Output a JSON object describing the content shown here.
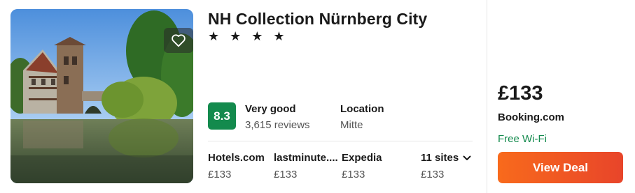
{
  "hotel": {
    "name": "NH Collection Nürnberg City",
    "stars": "★ ★ ★ ★",
    "star_count": 4,
    "favorite_icon": "heart-outline-icon"
  },
  "rating": {
    "score": "8.3",
    "label": "Very good",
    "reviews": "3,615 reviews",
    "badge_color": "#138a4d"
  },
  "location": {
    "label": "Location",
    "value": "Mitte"
  },
  "sites": [
    {
      "name": "Hotels.com",
      "price": "£133"
    },
    {
      "name": "lastminute....",
      "price": "£133"
    },
    {
      "name": "Expedia",
      "price": "£133"
    }
  ],
  "more_sites": {
    "label": "11 sites",
    "price": "£133",
    "icon": "chevron-down-icon"
  },
  "deal": {
    "price": "£133",
    "provider": "Booking.com",
    "amenity": "Free Wi-Fi",
    "amenity_color": "#138a4d",
    "button_label": "View Deal",
    "button_color": "#f2582a"
  }
}
